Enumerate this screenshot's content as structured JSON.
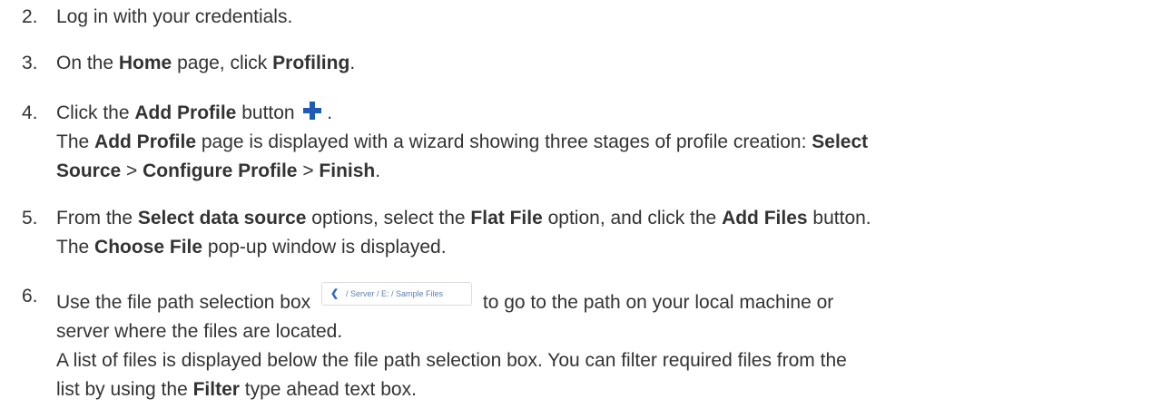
{
  "steps": [
    {
      "number": "2.",
      "line1": "Log in with your credentials."
    },
    {
      "number": "3.",
      "t1": "On the ",
      "b1": "Home",
      "t2": " page, click ",
      "b2": "Profiling",
      "t3": "."
    },
    {
      "number": "4.",
      "t1": "Click the ",
      "b1": "Add Profile",
      "t2": " button",
      "icon": "plus-icon",
      "t3": " .",
      "p2_t1": "The ",
      "p2_b1": "Add Profile",
      "p2_t2": " page is displayed with a wizard showing three stages of profile creation: ",
      "p2_b2": "Select",
      "p2_b3": "Source",
      "p2_t3": " > ",
      "p2_b4": "Configure Profile",
      "p2_t4": " > ",
      "p2_b5": "Finish",
      "p2_t5": "."
    },
    {
      "number": "5.",
      "t1": "From the ",
      "b1": "Select data source",
      "t2": " options, select the ",
      "b2": "Flat File",
      "t3": " option, and click the ",
      "b3": "Add Files",
      "t4": " button.",
      "p2_t1": "The ",
      "p2_b1": "Choose File",
      "p2_t2": " pop-up window is displayed."
    },
    {
      "number": "6.",
      "t1": "Use the file path selection box",
      "path_box": {
        "chevron_icon": "chevron-left-icon",
        "path": "/ Server / E: / Sample Files"
      },
      "t2": "to go to the path on your local machine or",
      "line2": "server where the files are located.",
      "p2_line1": "A list of files is displayed below the file path selection box. You can filter required files from the",
      "p2_t1": "list by using the ",
      "p2_b1": "Filter",
      "p2_t2": " type ahead text box."
    }
  ]
}
